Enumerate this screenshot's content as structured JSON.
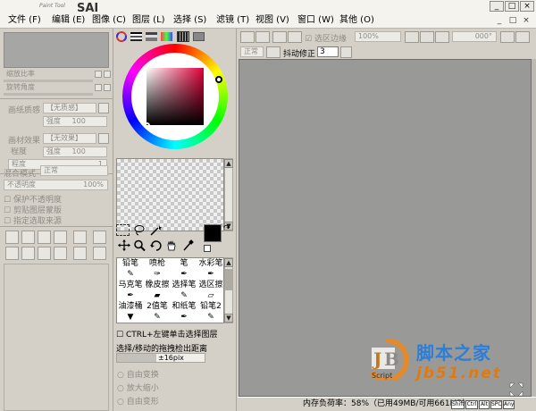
{
  "app": {
    "logo_text": "PaintTool SAI",
    "logo_lettering": "PaintTool SAI"
  },
  "menu": [
    {
      "label": "文件 (F)"
    },
    {
      "label": "编辑 (E)"
    },
    {
      "label": "图像 (C)"
    },
    {
      "label": "图层 (L)"
    },
    {
      "label": "选择 (S)"
    },
    {
      "label": "滤镜 (T)"
    },
    {
      "label": "视图 (V)"
    },
    {
      "label": "窗口 (W)"
    },
    {
      "label": "其他 (O)"
    }
  ],
  "window_controls": {
    "min": "_",
    "max": "□",
    "close": "×"
  },
  "nav_panel": {
    "zoom_label": "缩放比率",
    "rotate_label": "旋转角度"
  },
  "layer_props": {
    "paper_texture_label": "画纸质感",
    "paper_texture_value": "【无质感】",
    "paper_strength_label": "强度",
    "paper_strength_value": "100",
    "paper_effect_label": "画材效果",
    "paper_effect_value": "【无效果】",
    "effect_strength_label": "强度",
    "effect_strength_value": "100",
    "effect_degree_label": "程度",
    "effect_degree_value": "1"
  },
  "blend": {
    "mode_label": "混合模式",
    "mode_value": "正常",
    "opacity_label": "不透明度",
    "opacity_value": "100%",
    "protect_opacity": "保护不透明度",
    "clip_group": "剪贴图层蒙版",
    "selection_source": "指定选取来源"
  },
  "selection_opts": {
    "auto_expand": "自由变换",
    "auto_shrink": "放大缩小",
    "auto_rotate": "自由变形"
  },
  "color_tabs": [
    "色轮",
    "RGB滑块",
    "HSV滑块",
    "色板",
    "调色板",
    "中间色"
  ],
  "colors": {
    "primary": "#000000",
    "secondary": "#ffffff",
    "hue_center": "#e0003a",
    "canvas_gray": "#999a98",
    "ui_bg": "#d4d0c8"
  },
  "brush_tools": [
    {
      "label": "铅笔"
    },
    {
      "label": "喷枪"
    },
    {
      "label": "笔"
    },
    {
      "label": "水彩笔"
    },
    {
      "label": "马克笔"
    },
    {
      "label": "橡皮擦"
    },
    {
      "label": "选择笔"
    },
    {
      "label": "选区擦"
    },
    {
      "label": "油漆桶"
    },
    {
      "label": "2值笔"
    },
    {
      "label": "和纸笔"
    },
    {
      "label": "铅笔2"
    }
  ],
  "hints": {
    "ctrl_select": "CTRL+左键单击选择图层",
    "drag_label": "选择/移动的拖拽检出距离",
    "drag_value": "±16pix"
  },
  "toolbar": {
    "selection_stroke": "选区边缘",
    "zoom_value": "100%",
    "angle_value": "000°",
    "normal_label": "正常",
    "stabilizer_label": "抖动修正",
    "stabilizer_value": "3"
  },
  "status": {
    "text": "内存负荷率：58%（已用49MB/可用661MB）",
    "keys": [
      "Shift",
      "Ctrl",
      "Alt",
      "SPC",
      "Any"
    ]
  },
  "watermark": {
    "main": "脚本之家",
    "sub": "jb51.net",
    "script": "Script",
    "logo_lettering": "JB"
  }
}
